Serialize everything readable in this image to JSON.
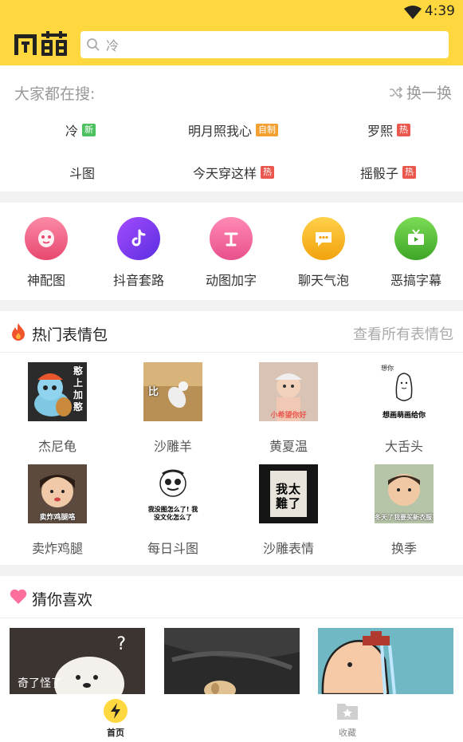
{
  "status": {
    "time": "4:39"
  },
  "header": {
    "logo_text": "闪萌",
    "search_value": "冷"
  },
  "hot_search": {
    "title": "大家都在搜:",
    "refresh_label": "换一换",
    "keywords": [
      {
        "text": "冷",
        "tag": "新",
        "tag_type": "new"
      },
      {
        "text": "明月照我心",
        "tag": "自制",
        "tag_type": "self"
      },
      {
        "text": "罗熙",
        "tag": "热",
        "tag_type": "hot"
      },
      {
        "text": "斗图",
        "tag": "",
        "tag_type": ""
      },
      {
        "text": "今天穿这样",
        "tag": "热",
        "tag_type": "hot"
      },
      {
        "text": "摇骰子",
        "tag": "热",
        "tag_type": "hot"
      }
    ]
  },
  "tools": [
    {
      "label": "神配图",
      "icon": "mask-icon",
      "color": "#f26b8a"
    },
    {
      "label": "抖音套路",
      "icon": "tiktok-icon",
      "color": "#7a3cf0"
    },
    {
      "label": "动图加字",
      "icon": "text-icon",
      "color": "#f56aa0"
    },
    {
      "label": "聊天气泡",
      "icon": "chat-bubble-icon",
      "color": "#f6b321"
    },
    {
      "label": "恶搞字幕",
      "icon": "tv-icon",
      "color": "#56c33d"
    }
  ],
  "popular": {
    "title": "热门表情包",
    "more_label": "查看所有表情包",
    "packs": [
      {
        "name": "杰尼龟",
        "caption": "憨上加憨"
      },
      {
        "name": "沙雕羊",
        "caption": "比"
      },
      {
        "name": "黄夏温",
        "caption": "小希望你好"
      },
      {
        "name": "大舌头",
        "caption": "想画萌画给你"
      },
      {
        "name": "卖炸鸡腿",
        "caption": "卖炸鸡腿咯"
      },
      {
        "name": "每日斗图",
        "caption": "我没图怎么了! 我没文化怎么了"
      },
      {
        "name": "沙雕表情",
        "caption": "我太難了"
      },
      {
        "name": "换季",
        "caption": "冬天了我要买新衣服了"
      }
    ]
  },
  "guess": {
    "title": "猜你喜欢",
    "cards": [
      {
        "caption": "奇了怪了",
        "mark": "?"
      },
      {
        "caption": "",
        "mark": ""
      },
      {
        "caption": "",
        "mark": ""
      }
    ]
  },
  "tabbar": {
    "tabs": [
      {
        "label": "首页",
        "icon": "lightning-icon",
        "active": true
      },
      {
        "label": "收藏",
        "icon": "star-folder-icon",
        "active": false
      }
    ]
  },
  "colors": {
    "brand_yellow": "#ffd83f",
    "tag_new": "#4cc15f",
    "tag_self": "#f3a030",
    "tag_hot": "#e9574d"
  }
}
